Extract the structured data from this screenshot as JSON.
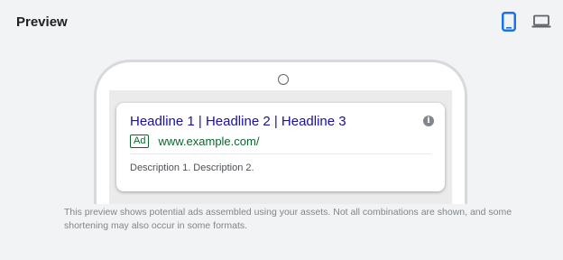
{
  "header": {
    "title": "Preview",
    "icons": {
      "mobile": "mobile-phone-icon",
      "desktop": "laptop-icon"
    },
    "selected_device": "mobile"
  },
  "ad": {
    "headline": "Headline 1 | Headline 2 | Headline 3",
    "badge": "Ad",
    "display_url": "www.example.com/",
    "description": "Description 1. Description 2.",
    "info_icon": "info-icon"
  },
  "disclaimer": "This preview shows potential ads assembled using your assets. Not all combinations are shown, and some shortening may also occur in some formats.",
  "colors": {
    "accent": "#1a73e8",
    "headline": "#1a0dab",
    "url": "#0d652d",
    "background": "#f1f3f4"
  }
}
